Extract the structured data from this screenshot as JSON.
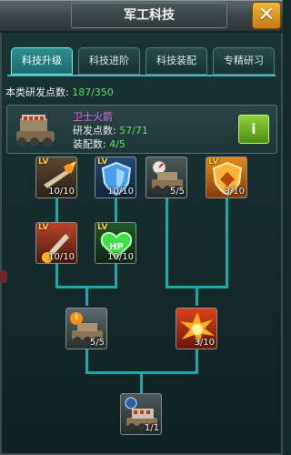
{
  "header": {
    "title": "军工科技",
    "close_label": "✕"
  },
  "tabs": [
    {
      "label": "科技升级",
      "active": true
    },
    {
      "label": "科技进阶",
      "active": false
    },
    {
      "label": "科技装配",
      "active": false
    },
    {
      "label": "专精研习",
      "active": false
    }
  ],
  "points": {
    "label": "本类研发点数:",
    "value": "187/350"
  },
  "unit": {
    "name": "卫士火箭",
    "rd_label": "研发点数:",
    "rd_value": "57/71",
    "equip_label": "装配数:",
    "equip_value": "4/5",
    "info_button": "i"
  },
  "tree": {
    "nodes": [
      {
        "icon": "muzzle-flash-icon",
        "count": "10/10",
        "lv": "LV"
      },
      {
        "icon": "shield-icon",
        "count": "10/10",
        "lv": "LV"
      },
      {
        "icon": "speed-tank-icon",
        "count": "5/5",
        "lv": ""
      },
      {
        "icon": "armor-shield-icon",
        "count": "3/10",
        "lv": "LV"
      },
      {
        "icon": "missile-icon",
        "count": "10/10",
        "lv": "LV"
      },
      {
        "icon": "hp-heart-icon",
        "count": "10/10",
        "lv": "LV"
      },
      {
        "icon": "fire-tank-icon",
        "count": "5/5",
        "lv": ""
      },
      {
        "icon": "explosion-icon",
        "count": "3/10",
        "lv": ""
      },
      {
        "icon": "rocket-tank-icon",
        "count": "1/1",
        "lv": ""
      }
    ]
  }
}
